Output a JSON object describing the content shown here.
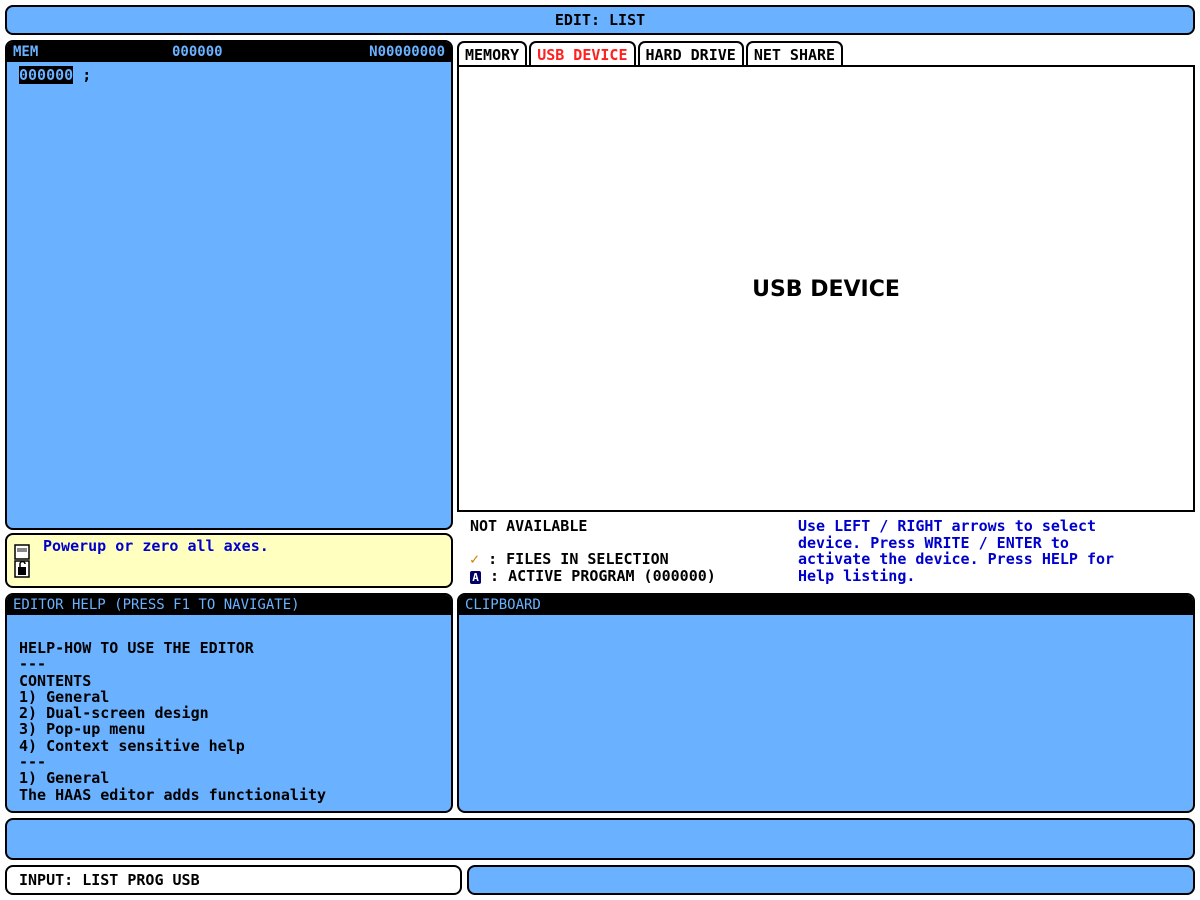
{
  "title": "EDIT: LIST",
  "mem": {
    "label": "MEM",
    "prog_num": "000000",
    "n_num": "N00000000",
    "code_highlight": "000000",
    "code_rest": " ;"
  },
  "message": {
    "icon": "door-lock-icon",
    "text": "Powerup or zero all axes."
  },
  "help": {
    "header": "EDITOR HELP (PRESS F1 TO NAVIGATE)",
    "lines": [
      "HELP-HOW TO USE THE EDITOR",
      "---",
      "CONTENTS",
      "1) General",
      "2) Dual-screen design",
      "3) Pop-up menu",
      "4) Context sensitive help",
      "---",
      "1) General",
      "The HAAS editor adds functionality"
    ]
  },
  "tabs": [
    "MEMORY",
    "USB DEVICE",
    "HARD DRIVE",
    "NET SHARE"
  ],
  "active_tab": "USB DEVICE",
  "device_label": "USB DEVICE",
  "status": {
    "availability": "NOT AVAILABLE",
    "files_in_selection": ": FILES IN SELECTION",
    "active_program": ": ACTIVE PROGRAM (000000)",
    "check_glyph": "✓",
    "a_glyph": "A",
    "instructions": [
      "Use LEFT / RIGHT arrows to select",
      "device. Press WRITE / ENTER to",
      "activate the device. Press HELP for",
      "Help listing."
    ]
  },
  "clipboard": {
    "header": "CLIPBOARD"
  },
  "input": {
    "text": "INPUT: LIST PROG USB"
  },
  "colors": {
    "panel_blue": "#6ab1ff",
    "message_yellow": "#ffffc0",
    "active_tab_red": "#ff2020",
    "help_text_blue": "#0000cc"
  }
}
